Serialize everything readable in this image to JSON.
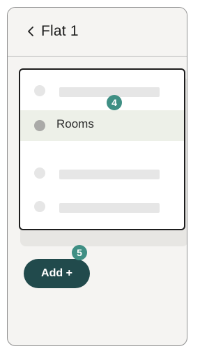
{
  "header": {
    "back_icon": "chevron-left-icon",
    "title": "Flat 1"
  },
  "list": {
    "selected_item": "Rooms"
  },
  "annotations": {
    "step_4": "4",
    "step_5": "5",
    "badge_color": "#3f8f84"
  },
  "actions": {
    "add_label": "Add +",
    "add_color": "#214a4c"
  }
}
